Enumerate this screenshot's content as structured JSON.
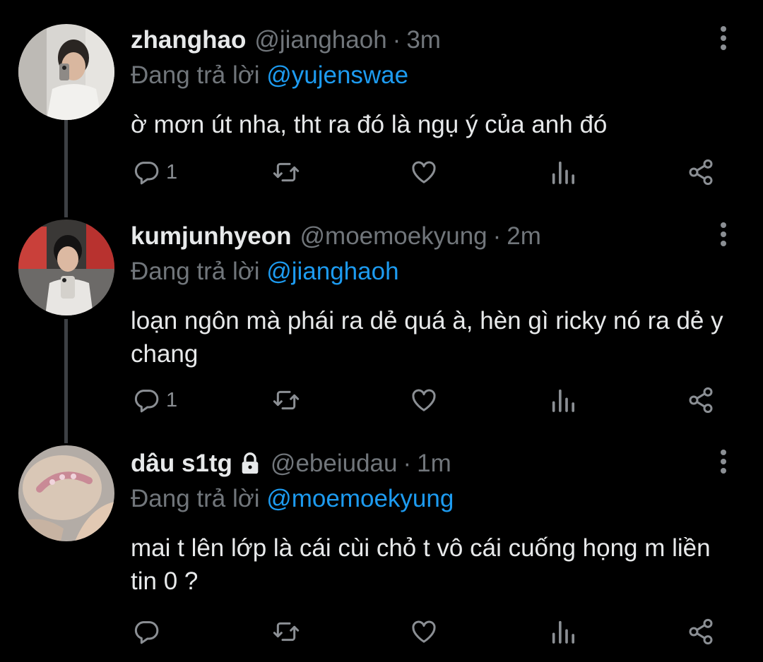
{
  "tweets": [
    {
      "name": "zhanghao",
      "handle": "@jianghaoh",
      "time": "3m",
      "reply_prefix": "Đang trả lời",
      "reply_to": "@yujenswae",
      "text": "ờ mơn út nha, tht ra đó là ngụ ý của anh đó",
      "reply_count": "1",
      "locked": false
    },
    {
      "name": "kumjunhyeon",
      "handle": "@moemoekyung",
      "time": "2m",
      "reply_prefix": "Đang trả lời",
      "reply_to": "@jianghaoh",
      "text": "loạn ngôn mà phái ra dẻ quá à, hèn gì ricky nó ra dẻ y chang",
      "reply_count": "1",
      "locked": false
    },
    {
      "name": "dâu s1tg",
      "handle": "@ebeiudau",
      "time": "1m",
      "reply_prefix": "Đang trả lời",
      "reply_to": "@moemoekyung",
      "text": "mai t lên lớp là cái cùi chỏ t vô cái cuống họng m liền tin 0 ?",
      "reply_count": "",
      "locked": true
    }
  ],
  "separator": "·",
  "icons": {
    "reply": "reply-icon",
    "retweet": "retweet-icon",
    "like": "heart-icon",
    "views": "views-icon",
    "share": "share-icon",
    "more": "more-vertical-icon",
    "lock": "lock-icon"
  },
  "colors": {
    "background": "#000000",
    "text": "#e7e9ea",
    "muted": "#71767b",
    "link": "#1d9bf0",
    "icon": "#8b8f94",
    "thread_line": "#3d4044"
  }
}
